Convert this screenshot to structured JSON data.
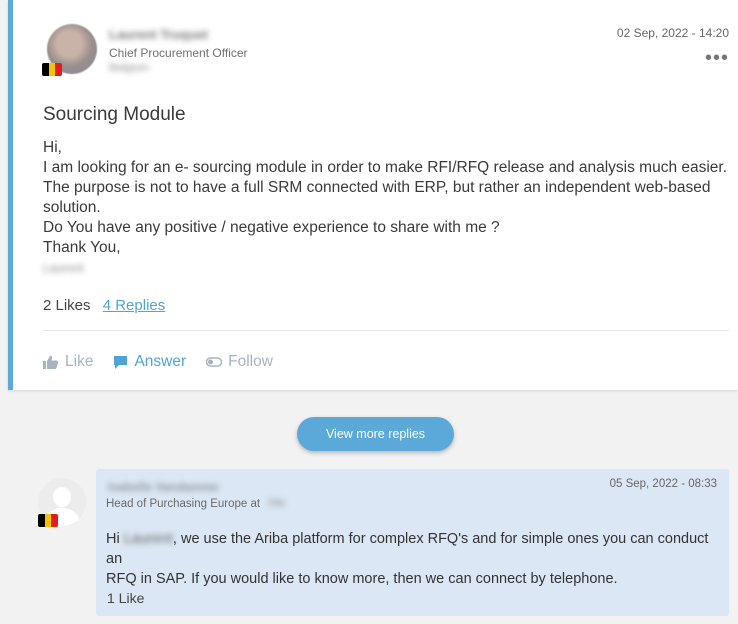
{
  "post": {
    "author": {
      "name": "Laurent Truquet",
      "role": "Chief Procurement Officer",
      "location": "Belgium",
      "flag_colors": [
        "#000000",
        "#f5c400",
        "#e21b1b"
      ]
    },
    "timestamp": "02 Sep, 2022 - 14:20",
    "more_icon": "more-dots-icon",
    "title": "Sourcing Module",
    "body_lines": [
      "Hi,",
      "I am looking for an e- sourcing module in order to make RFI/RFQ release and analysis much easier.",
      "The purpose is not to have a full SRM connected with ERP, but rather an independent web-based",
      "solution.",
      "Do You have any positive / negative experience to share with me ?",
      "Thank You,"
    ],
    "signature": "Laurent",
    "likes_text": "2 Likes",
    "replies_text": "4 Replies",
    "actions": {
      "like": "Like",
      "answer": "Answer",
      "follow": "Follow"
    }
  },
  "view_more_label": "View more replies",
  "reply": {
    "author_name": "Isabelle Vandamme",
    "role_prefix": "Head of Purchasing Europe",
    "at_label": "at",
    "company": "TRI",
    "timestamp": "05 Sep, 2022 - 08:33",
    "flag_colors": [
      "#000000",
      "#f5c400",
      "#e21b1b"
    ],
    "body_hi": "Hi",
    "body_name": "Laurent",
    "body_line1_rest": ", we use the Ariba platform  for complex RFQ's and for simple ones you can conduct an",
    "body_line2": "RFQ in SAP. If you would like to know more, then we can connect by telephone.",
    "likes_text": "1 Like"
  },
  "colors": {
    "accent": "#5aa9d8",
    "link": "#4ea4d6",
    "reply_bg": "#dbe7f4",
    "muted_action": "#a8b4bd"
  }
}
